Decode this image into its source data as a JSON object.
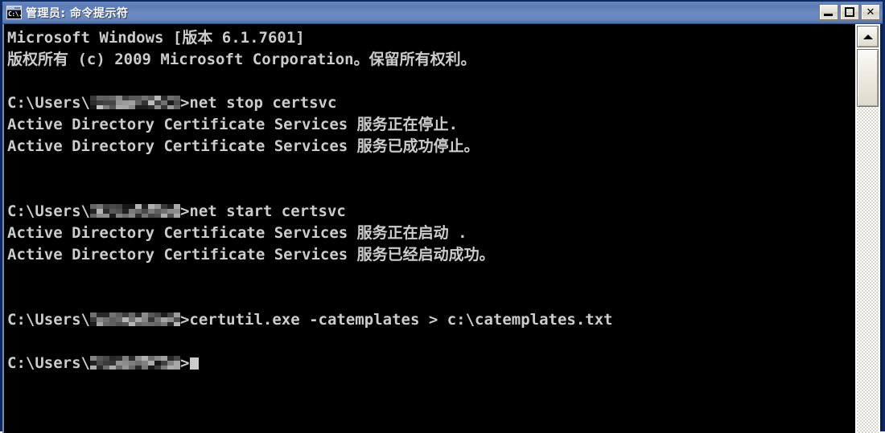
{
  "window": {
    "title": "管理员: 命令提示符",
    "icon": "cmd-console-icon",
    "icon_glyph": "C:\\.",
    "colors": {
      "titlebar_blue": "#5c7cb6",
      "console_bg": "#000000",
      "console_fg": "#cccccc",
      "border_navy": "#0d2b63"
    },
    "buttons": {
      "minimize": "minimize",
      "maximize": "maximize",
      "close": "✕"
    }
  },
  "console": {
    "prompt_prefix": "C:\\Users\\",
    "prompt_suffix": ">",
    "redacted_label": "username-redacted",
    "lines": [
      {
        "type": "text",
        "text": "Microsoft Windows [版本 6.1.7601]"
      },
      {
        "type": "text",
        "text": "版权所有 (c) 2009 Microsoft Corporation。保留所有权利。"
      },
      {
        "type": "blank",
        "text": ""
      },
      {
        "type": "prompt",
        "command": "net stop certsvc"
      },
      {
        "type": "text",
        "text": "Active Directory Certificate Services 服务正在停止."
      },
      {
        "type": "text",
        "text": "Active Directory Certificate Services 服务已成功停止。"
      },
      {
        "type": "blank",
        "text": ""
      },
      {
        "type": "blank",
        "text": ""
      },
      {
        "type": "prompt",
        "command": "net start certsvc"
      },
      {
        "type": "text",
        "text": "Active Directory Certificate Services 服务正在启动 ."
      },
      {
        "type": "text",
        "text": "Active Directory Certificate Services 服务已经启动成功。"
      },
      {
        "type": "blank",
        "text": ""
      },
      {
        "type": "blank",
        "text": ""
      },
      {
        "type": "prompt",
        "command": "certutil.exe -catemplates > c:\\catemplates.txt"
      },
      {
        "type": "blank",
        "text": ""
      },
      {
        "type": "prompt",
        "command": "",
        "cursor": true
      }
    ]
  },
  "scrollbar": {
    "up_arrow": "scroll-up-arrow",
    "thumb": "scroll-thumb",
    "track": "scroll-track"
  }
}
